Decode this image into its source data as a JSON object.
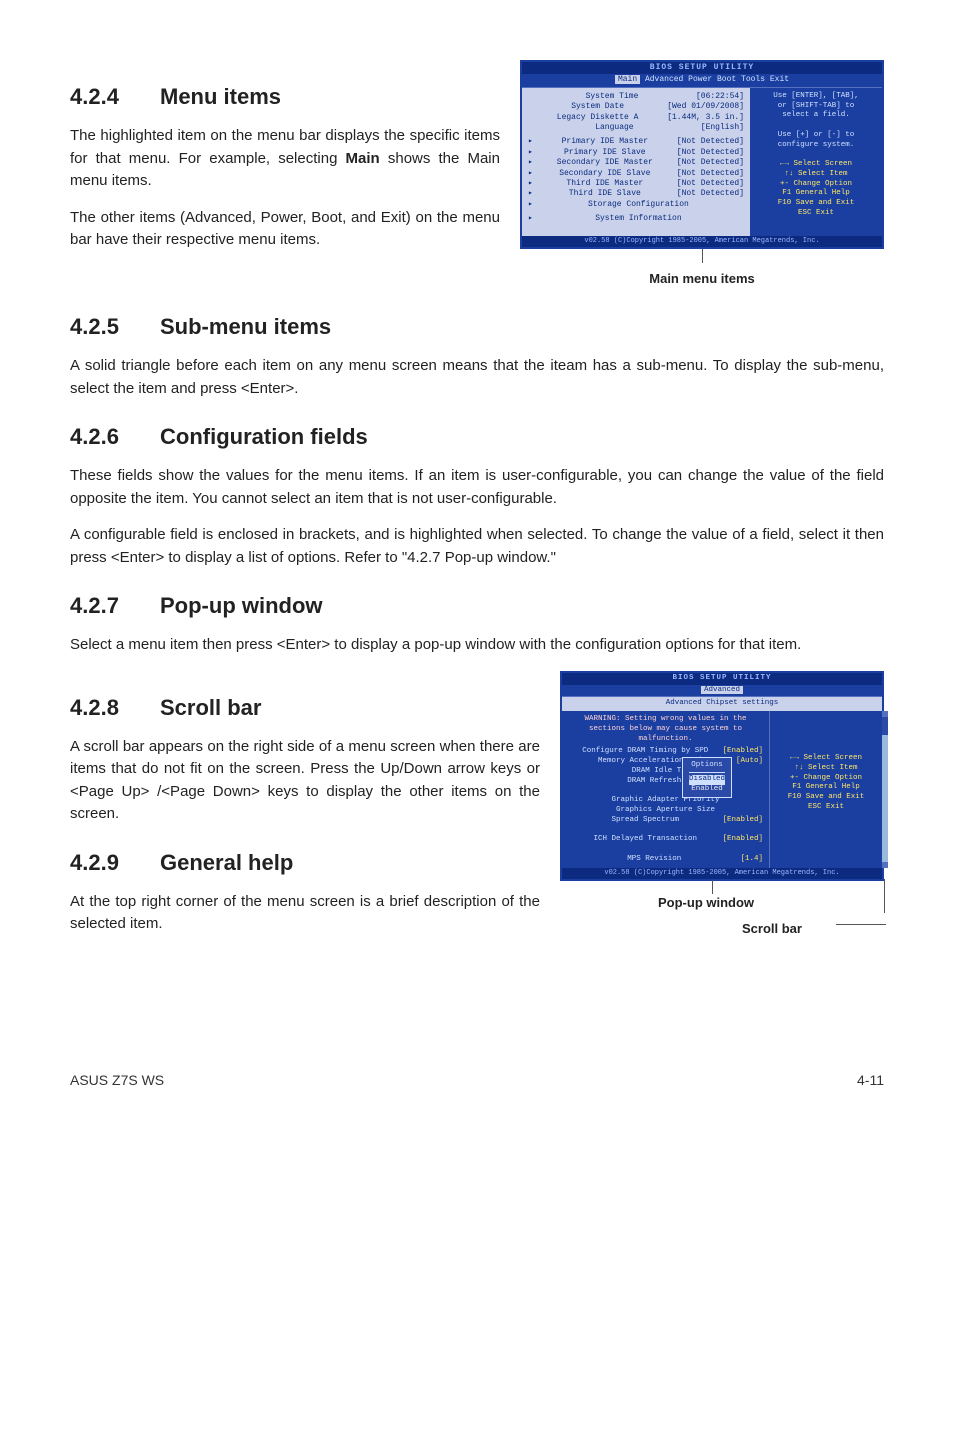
{
  "sec424": {
    "num": "4.2.4",
    "title": "Menu items",
    "p1": "The highlighted item on the menu bar displays the specific items for that menu. For example, selecting ",
    "p1b": "Main",
    "p1c": " shows the Main menu items.",
    "p2": "The other items (Advanced, Power, Boot, and Exit) on the menu bar have their respective menu items.",
    "caption": "Main menu items"
  },
  "sec425": {
    "num": "4.2.5",
    "title": "Sub-menu items",
    "p1": "A solid triangle before each item on any menu screen means that the iteam has a sub-menu. To display the sub-menu, select the item and press <Enter>."
  },
  "sec426": {
    "num": "4.2.6",
    "title": "Configuration fields",
    "p1": "These fields show the values for the menu items. If an item is user-configurable, you can change the value of the field opposite the item. You cannot select an item that is not user-configurable.",
    "p2": "A configurable field is enclosed in brackets, and is highlighted when selected. To change the value of a field, select it then press <Enter> to display a list of options. Refer to \"4.2.7 Pop-up window.\""
  },
  "sec427": {
    "num": "4.2.7",
    "title": "Pop-up window",
    "p1": "Select a menu item then press <Enter> to display a pop-up window with the configuration options for that item."
  },
  "sec428": {
    "num": "4.2.8",
    "title": "Scroll bar",
    "p1": "A scroll bar appears on the right side of a menu screen when there are items that do not fit on the screen. Press the Up/Down arrow keys or <Page Up> /<Page Down> keys to display the other items on the screen."
  },
  "sec429": {
    "num": "4.2.9",
    "title": "General help",
    "p1": "At the top right corner of the menu screen is a brief description of the selected item.",
    "caption_popup": "Pop-up window",
    "caption_scroll": "Scroll bar"
  },
  "bios1": {
    "title": "BIOS SETUP UTILITY",
    "tabs": [
      "Main",
      "Advanced",
      "Power",
      "Boot",
      "Tools",
      "Exit"
    ],
    "rows": [
      {
        "k": "System Time",
        "v": "[06:22:54]"
      },
      {
        "k": "System Date",
        "v": "[Wed 01/09/2008]"
      },
      {
        "k": "Legacy Diskette A",
        "v": "[1.44M, 3.5 in.]"
      },
      {
        "k": "Language",
        "v": "[English]"
      }
    ],
    "subrows": [
      {
        "k": "Primary IDE Master",
        "v": "[Not Detected]"
      },
      {
        "k": "Primary IDE Slave",
        "v": "[Not Detected]"
      },
      {
        "k": "Secondary IDE Master",
        "v": "[Not Detected]"
      },
      {
        "k": "Secondary IDE Slave",
        "v": "[Not Detected]"
      },
      {
        "k": "Third IDE Master",
        "v": "[Not Detected]"
      },
      {
        "k": "Third IDE Slave",
        "v": "[Not Detected]"
      },
      {
        "k": "Storage Configuration",
        "v": ""
      },
      {
        "k": "System Information",
        "v": ""
      }
    ],
    "help": [
      "Use [ENTER], [TAB],",
      "or [SHIFT-TAB] to",
      "select a field.",
      "",
      "Use [+] or [-] to",
      "configure system."
    ],
    "keys": [
      "←→   Select Screen",
      "↑↓   Select Item",
      "+-   Change Option",
      "F1   General Help",
      "F10  Save and Exit",
      "ESC  Exit"
    ],
    "footer": "v02.58 (C)Copyright 1985-2005, American Megatrends, Inc."
  },
  "bios2": {
    "title": "BIOS SETUP UTILITY",
    "tab": "Advanced",
    "hdr": "Advanced Chipset settings",
    "warn": "WARNING: Setting wrong values in the sections below may cause system to malfunction.",
    "rows": [
      {
        "k": "Configure DRAM Timing by SPD",
        "v": "[Enabled]"
      },
      {
        "k": "Memory Acceleration Mode",
        "v": "[Auto]"
      },
      {
        "k": "DRAM Idle Timer",
        "v": ""
      },
      {
        "k": "DRAM Refresh Rate",
        "v": ""
      },
      {
        "k": "",
        "v": ""
      },
      {
        "k": "Graphic Adapter Priority",
        "v": ""
      },
      {
        "k": "Graphics Aperture Size",
        "v": ""
      },
      {
        "k": "Spread Spectrum",
        "v": "[Enabled]"
      },
      {
        "k": "",
        "v": ""
      },
      {
        "k": "ICH Delayed Transaction",
        "v": "[Enabled]"
      },
      {
        "k": "",
        "v": ""
      },
      {
        "k": "MPS Revision",
        "v": "[1.4]"
      }
    ],
    "popup_title": "Options",
    "popup_opts": [
      "Disabled",
      "Enabled"
    ],
    "keys": [
      "←→   Select Screen",
      "↑↓   Select Item",
      "+-   Change Option",
      "F1   General Help",
      "F10  Save and Exit",
      "ESC  Exit"
    ],
    "footer": "v02.58 (C)Copyright 1985-2005, American Megatrends, Inc."
  },
  "footer": {
    "left": "ASUS Z7S WS",
    "right": "4-11"
  }
}
